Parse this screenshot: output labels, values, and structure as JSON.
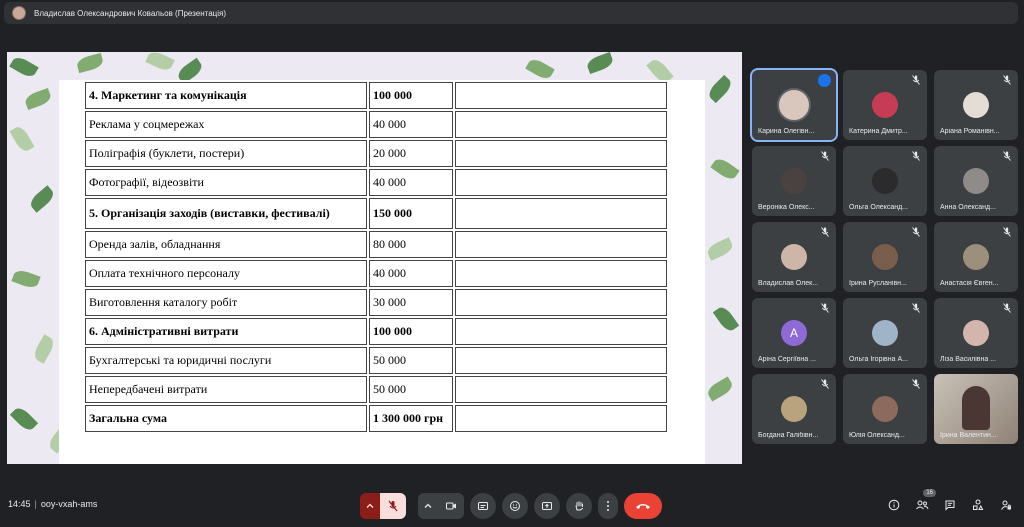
{
  "topbar": {
    "title": "Владислав Олександрович Ковальов (Презентація)"
  },
  "slide": {
    "rows": [
      {
        "item": "4. Маркетинг та комунікація",
        "amount": "100 000",
        "note": "",
        "bold": true
      },
      {
        "item": "Реклама у соцмережах",
        "amount": "40 000",
        "note": ""
      },
      {
        "item": "Поліграфія (буклети, постери)",
        "amount": "20 000",
        "note": ""
      },
      {
        "item": "Фотографії, відеозвіти",
        "amount": "40 000",
        "note": ""
      },
      {
        "item": "5. Організація заходів (виставки, фестивалі)",
        "amount": "150 000",
        "note": "",
        "bold": true,
        "tall": true
      },
      {
        "item": "Оренда залів, обладнання",
        "amount": "80 000",
        "note": ""
      },
      {
        "item": "Оплата технічного персоналу",
        "amount": "40 000",
        "note": ""
      },
      {
        "item": "Виготовлення каталогу робіт",
        "amount": "30 000",
        "note": ""
      },
      {
        "item": "6. Адміністративні витрати",
        "amount": "100 000",
        "note": "",
        "bold": true
      },
      {
        "item": "Бухгалтерські та юридичні послуги",
        "amount": "50 000",
        "note": ""
      },
      {
        "item": "Непередбачені витрати",
        "amount": "50 000",
        "note": ""
      },
      {
        "item": "Загальна сума",
        "amount": "1 300 000 грн",
        "note": "",
        "bold": true
      }
    ]
  },
  "participants": [
    {
      "name": "Карина Олегівн...",
      "speaking": true,
      "avatar_color": "#d9c6bd"
    },
    {
      "name": "Катерина Дмитр...",
      "avatar_color": "#c73c55"
    },
    {
      "name": "Аріана Романівн...",
      "avatar_color": "#e6dcd6"
    },
    {
      "name": "Вероніка Олекс...",
      "avatar_color": "#4a4240"
    },
    {
      "name": "Ольга Олександ...",
      "avatar_color": "#2b2a2c"
    },
    {
      "name": "Анна Олександ...",
      "avatar_color": "#8e8b88"
    },
    {
      "name": "Владислав Олек...",
      "avatar_color": "#cdb6a8"
    },
    {
      "name": "Ірина Русланівн...",
      "avatar_color": "#7a5e4d"
    },
    {
      "name": "Анастасія Євген...",
      "avatar_color": "#9c8f7c"
    },
    {
      "name": "Аріна Сергіївна ...",
      "letter": "А",
      "avatar_color": "#8f6ad7"
    },
    {
      "name": "Ольга Ігорівна А...",
      "avatar_color": "#9fb4c9"
    },
    {
      "name": "Ліза Василівна ...",
      "avatar_color": "#d4b5ae"
    },
    {
      "name": "Богдана Галібівн...",
      "avatar_color": "#b9a37e"
    },
    {
      "name": "Юлія Олександ...",
      "avatar_color": "#8c6a5d"
    },
    {
      "name": "Ірина Валентин...",
      "video": true
    }
  ],
  "bottombar": {
    "time": "14:45",
    "separator": "|",
    "meeting_code": "ooy-vxah-ams",
    "participant_count": "16"
  },
  "colors": {
    "accent": "#8ab4f8",
    "end_call": "#ea4335",
    "mic_off_bg": "#f9dedc"
  }
}
